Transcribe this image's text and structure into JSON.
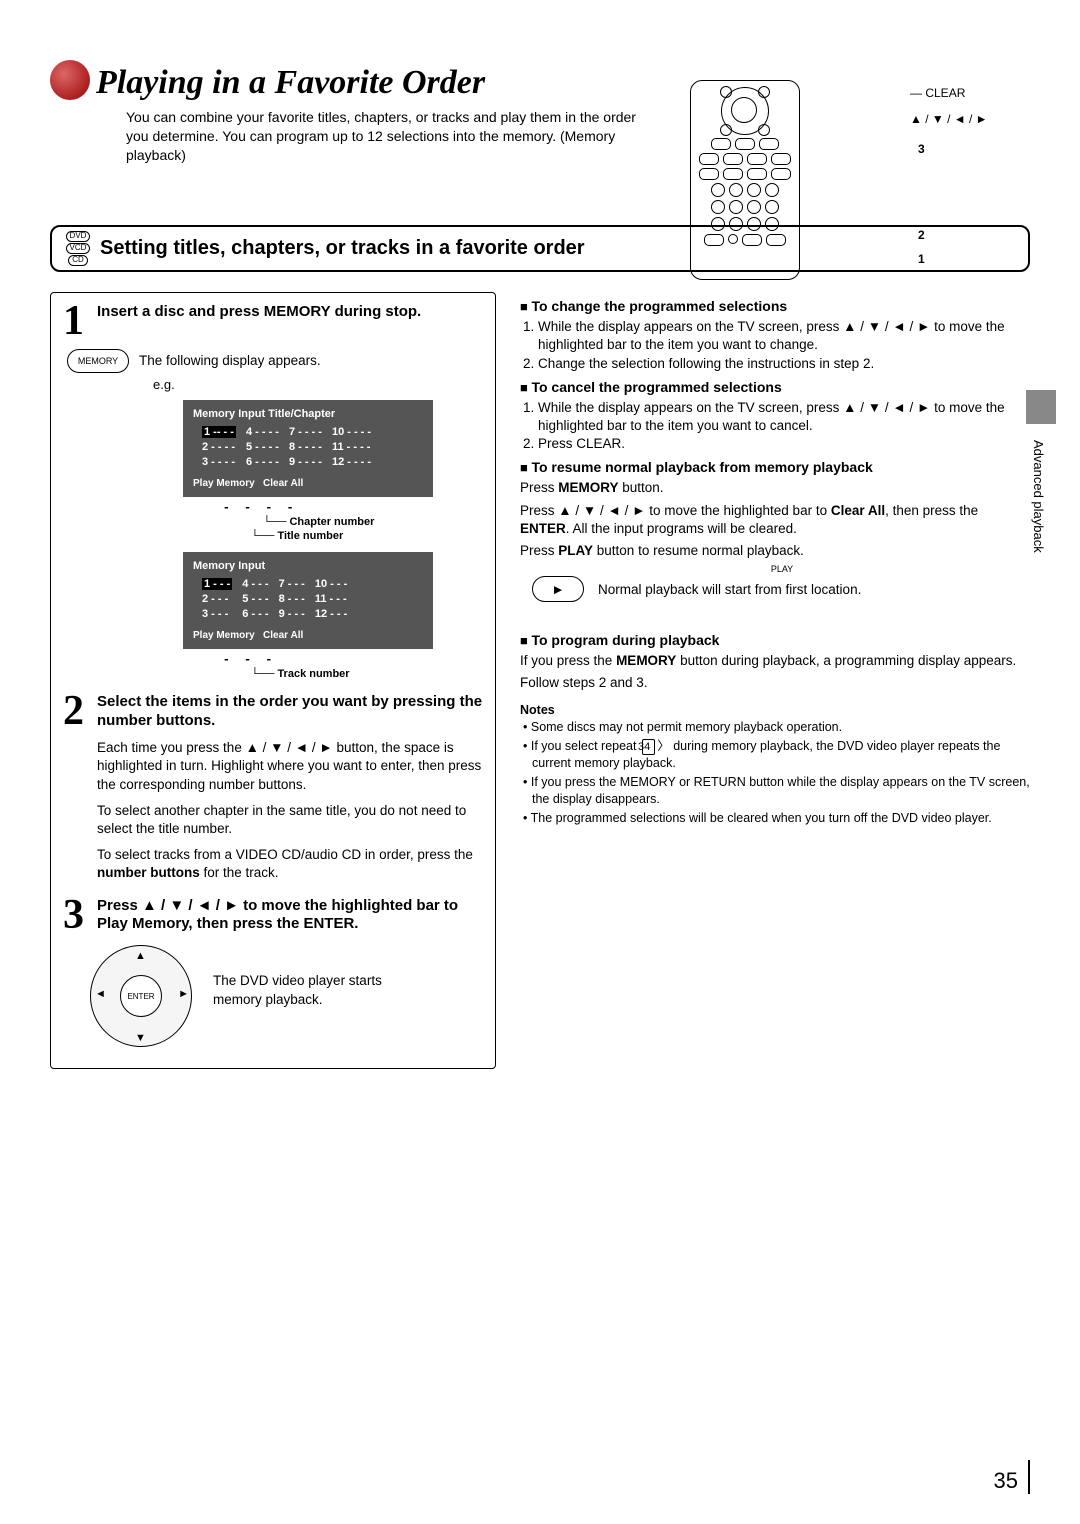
{
  "header": {
    "title": "Playing in a Favorite Order",
    "intro": "You can combine your favorite titles, chapters, or tracks and play them in the order you determine. You can program up to 12 selections into the memory. (Memory playback)"
  },
  "remote": {
    "label_clear": "CLEAR",
    "label_arrows": "▲ / ▼ / ◄ / ►",
    "callout_3": "3",
    "callout_2": "2",
    "callout_1": "1"
  },
  "section": {
    "discs": [
      "DVD",
      "VCD",
      "CD"
    ],
    "title": "Setting titles, chapters, or tracks in a favorite order"
  },
  "left": {
    "step1": {
      "num": "1",
      "title": "Insert a disc and press MEMORY during stop.",
      "memory_label": "MEMORY",
      "following": "The following display appears.",
      "eg": "e.g.",
      "display1": {
        "header": "Memory Input Title/Chapter",
        "rows": [
          [
            "1 -- - -",
            "4 - - - -",
            "7 - - - -",
            "10 - - - -"
          ],
          [
            "2 - - - -",
            "5 - - - -",
            "8 - - - -",
            "11 - - - -"
          ],
          [
            "3 - - - -",
            "6 - - - -",
            "9 - - - -",
            "12 - - - -"
          ]
        ],
        "footer": [
          "Play Memory",
          "Clear All"
        ]
      },
      "annot1_a": "Chapter number",
      "annot1_b": "Title number",
      "display2": {
        "header": "Memory Input",
        "rows": [
          [
            "1 - - -",
            "4 - - -",
            "7 - - -",
            "10 - - -"
          ],
          [
            "2 - - -",
            "5 - - -",
            "8 - - -",
            "11 - - -"
          ],
          [
            "3 - - -",
            "6 - - -",
            "9 - - -",
            "12 - - -"
          ]
        ],
        "footer": [
          "Play Memory",
          "Clear All"
        ]
      },
      "annot2": "Track number"
    },
    "step2": {
      "num": "2",
      "title": "Select the items in the order you want by pressing the number buttons.",
      "body1": "Each time you press the ▲ / ▼ / ◄ / ► button, the space is highlighted in turn. Highlight where you want to enter, then press the corresponding number buttons.",
      "body2": "To select another chapter in the same title, you do not need to select the title number.",
      "body3_a": "To select tracks from a VIDEO CD/audio CD in order, press the ",
      "body3_b": "number buttons",
      "body3_c": " for the track."
    },
    "step3": {
      "num": "3",
      "title": "Press ▲ / ▼ / ◄ / ► to move the highlighted bar to Play Memory, then press the ENTER.",
      "enter_label": "ENTER",
      "desc": "The DVD video player starts memory playback."
    }
  },
  "right": {
    "change": {
      "title": "To change the programmed selections",
      "item1": "While the display appears on the TV screen, press ▲ / ▼ / ◄ / ► to move the highlighted bar to the item you want to change.",
      "item2": "Change the selection following the instructions in step 2."
    },
    "cancel": {
      "title": "To cancel the programmed selections",
      "item1": "While the display appears on the TV screen, press ▲ / ▼ / ◄ / ► to move the highlighted bar to the item you want to cancel.",
      "item2": "Press CLEAR."
    },
    "resume": {
      "title": "To resume normal playback from memory playback",
      "p1_a": "Press ",
      "p1_b": "MEMORY",
      "p1_c": " button.",
      "p2_a": "Press ▲ / ▼ / ◄ / ► to move the highlighted bar to ",
      "p2_b": "Clear All",
      "p2_c": ", then press the ",
      "p2_d": "ENTER",
      "p2_e": ". All the input programs will be cleared.",
      "p3_a": "Press ",
      "p3_b": "PLAY",
      "p3_c": " button to resume normal playback.",
      "play_label": "PLAY",
      "play_desc": "Normal playback will start from first location."
    },
    "during": {
      "title": "To program during playback",
      "p1_a": "If you press the ",
      "p1_b": "MEMORY",
      "p1_c": " button during playback, a programming display appears.",
      "p2": "Follow steps 2 and 3."
    },
    "notes": {
      "title": "Notes",
      "n1": "Some discs may not permit memory playback operation.",
      "n2_a": "If you select repeat ",
      "n2_page": "34",
      "n2_b": " during memory playback, the DVD video player repeats the current memory playback.",
      "n3": "If you press the MEMORY or RETURN button while the display appears on the TV screen, the display disappears.",
      "n4": "The programmed selections will be cleared when you turn off the DVD video player."
    }
  },
  "side_label": "Advanced playback",
  "page_number": "35"
}
